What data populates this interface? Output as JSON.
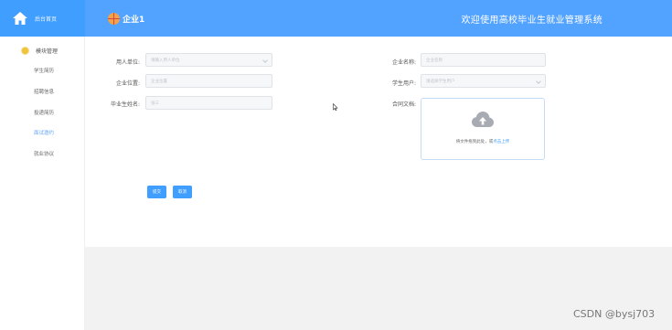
{
  "header": {
    "brand_label": "后台首页",
    "corp_name": "企业1",
    "welcome": "欢迎使用高校毕业生就业管理系统"
  },
  "sidebar": {
    "group_label": "模块管理",
    "items": [
      {
        "label": "学生简历",
        "active": false
      },
      {
        "label": "招聘信息",
        "active": false
      },
      {
        "label": "投递简历",
        "active": false
      },
      {
        "label": "面试邀约",
        "active": true
      },
      {
        "label": "就业协议",
        "active": false
      }
    ]
  },
  "form": {
    "employer_unit": {
      "label": "用人单位:",
      "placeholder": "请输入用人单位"
    },
    "company_name": {
      "label": "企业名称:",
      "placeholder": "企业名称"
    },
    "company_location": {
      "label": "企业位置:",
      "placeholder": "企业位置"
    },
    "student_user": {
      "label": "学生用户:",
      "placeholder": "请选择学生用户"
    },
    "graduate_name": {
      "label": "毕业生姓名:",
      "placeholder": "张三"
    },
    "contract_file": {
      "label": "合同文档:",
      "upload_text": "将文件拖到此处，或",
      "upload_link": "点击上传"
    }
  },
  "actions": {
    "submit_label": "提交",
    "cancel_label": "取消"
  },
  "watermark": "CSDN @bysj703",
  "colors": {
    "primary": "#409eff",
    "header_bg": "#52a2ff",
    "content_bg": "#f2f2f2"
  }
}
